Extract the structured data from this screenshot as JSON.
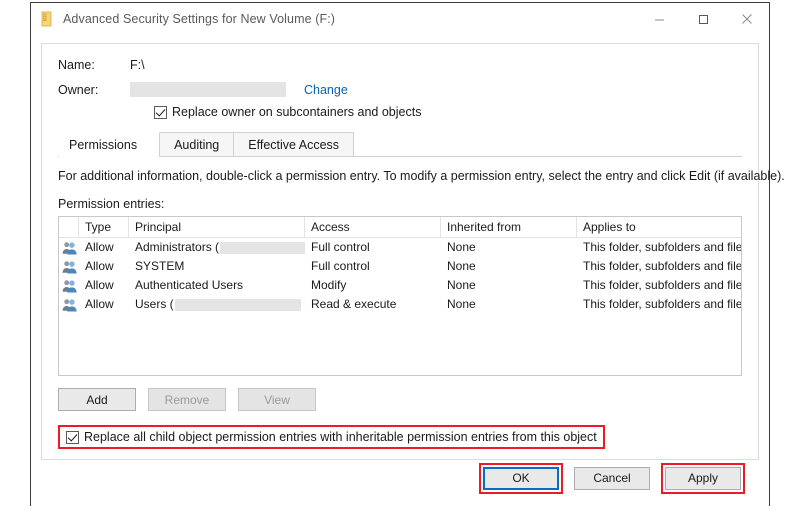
{
  "window": {
    "title": "Advanced Security Settings for New Volume (F:)",
    "icon": "security-folder-icon",
    "controls": {
      "minimize": "minimize-icon",
      "maximize": "maximize-icon",
      "close": "close-icon"
    }
  },
  "details": {
    "name_label": "Name:",
    "name_value": "F:\\",
    "owner_label": "Owner:",
    "owner_value": "",
    "change_link": "Change",
    "replace_owner_label": "Replace owner on subcontainers and objects",
    "replace_owner_checked": true
  },
  "tabs": [
    {
      "label": "Permissions",
      "active": true
    },
    {
      "label": "Auditing",
      "active": false
    },
    {
      "label": "Effective Access",
      "active": false
    }
  ],
  "info_text": "For additional information, double-click a permission entry. To modify a permission entry, select the entry and click Edit (if available).",
  "entries_label": "Permission entries:",
  "table": {
    "columns": [
      "",
      "Type",
      "Principal",
      "Access",
      "Inherited from",
      "Applies to"
    ],
    "rows": [
      {
        "icon": "users-group-icon",
        "type": "Allow",
        "principal": "Administrators (",
        "principal_redacted": true,
        "redact_width": 108,
        "access": "Full control",
        "inherited_from": "None",
        "applies_to": "This folder, subfolders and files"
      },
      {
        "icon": "users-group-icon",
        "type": "Allow",
        "principal": "SYSTEM",
        "principal_redacted": false,
        "redact_width": 0,
        "access": "Full control",
        "inherited_from": "None",
        "applies_to": "This folder, subfolders and files"
      },
      {
        "icon": "users-group-icon",
        "type": "Allow",
        "principal": "Authenticated Users",
        "principal_redacted": false,
        "redact_width": 0,
        "access": "Modify",
        "inherited_from": "None",
        "applies_to": "This folder, subfolders and files"
      },
      {
        "icon": "users-group-icon",
        "type": "Allow",
        "principal": "Users (",
        "principal_redacted": true,
        "redact_width": 126,
        "access": "Read & execute",
        "inherited_from": "None",
        "applies_to": "This folder, subfolders and files"
      }
    ]
  },
  "entry_buttons": [
    {
      "label": "Add",
      "disabled": false
    },
    {
      "label": "Remove",
      "disabled": true
    },
    {
      "label": "View",
      "disabled": true
    }
  ],
  "replace_child": {
    "label": "Replace all child object permission entries with inheritable permission entries from this object",
    "checked": true,
    "highlighted": true
  },
  "footer_buttons": [
    {
      "label": "OK",
      "focused": true,
      "highlighted": true
    },
    {
      "label": "Cancel",
      "focused": false,
      "highlighted": false
    },
    {
      "label": "Apply",
      "focused": false,
      "highlighted": true
    }
  ],
  "colors": {
    "annotation_red": "#ee1b24",
    "focus_blue": "#0a6cc4",
    "link_blue": "#0a5fb4",
    "redaction_gray": "#e4e4e4"
  }
}
